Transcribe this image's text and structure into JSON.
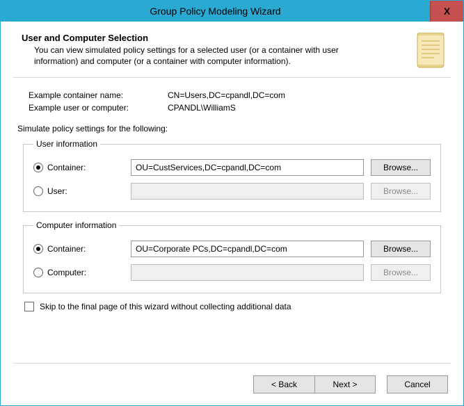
{
  "titlebar": {
    "title": "Group Policy Modeling Wizard",
    "close_label": "X"
  },
  "header": {
    "title": "User and Computer Selection",
    "desc": "You can view simulated policy settings for a selected user (or a container with user information) and computer (or a container with computer information)."
  },
  "examples": {
    "container_label": "Example container name:",
    "container_value": "CN=Users,DC=cpandl,DC=com",
    "user_label": "Example user or computer:",
    "user_value": "CPANDL\\WilliamS"
  },
  "simulate_label": "Simulate policy settings for the following:",
  "user_info": {
    "legend": "User information",
    "container_label": "Container:",
    "container_value": "OU=CustServices,DC=cpandl,DC=com",
    "user_label": "User:",
    "user_value": "",
    "browse_label": "Browse..."
  },
  "computer_info": {
    "legend": "Computer information",
    "container_label": "Container:",
    "container_value": "OU=Corporate PCs,DC=cpandl,DC=com",
    "computer_label": "Computer:",
    "computer_value": "",
    "browse_label": "Browse..."
  },
  "skip_label": "Skip to the final page of this wizard without collecting additional data",
  "footer": {
    "back": "< Back",
    "next": "Next >",
    "cancel": "Cancel"
  }
}
